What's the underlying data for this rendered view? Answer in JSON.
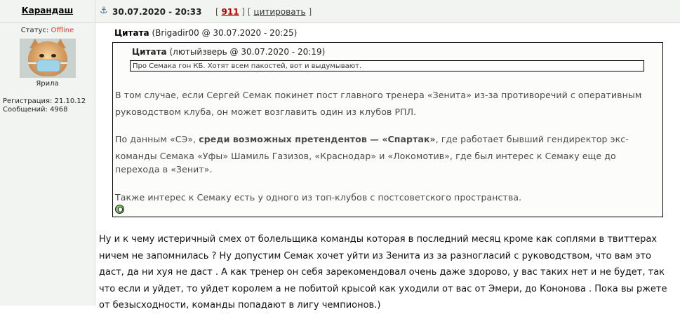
{
  "user": {
    "username": "Карандаш",
    "status_label": "Статус:",
    "status_value": "Offline",
    "avatar_caption": "Ярила",
    "registration_label": "Регистрация:",
    "registration_value": "21.10.12",
    "messages_label": "Сообщений:",
    "messages_value": "4968"
  },
  "post": {
    "datetime": "30.07.2020 - 20:33",
    "bracket_open": "[",
    "number": "911",
    "bracket_sep": "] [",
    "cite_label": "цитировать",
    "bracket_close": "]"
  },
  "quote": {
    "label": "Цитата",
    "meta": "(Brigadir00 @ 30.07.2020 - 20:25)",
    "inner_label": "Цитата",
    "inner_meta": "(лютыйзверь @ 30.07.2020 - 20:19)",
    "inner_text": "Про Семака гон КБ. Хотят всем пакостей, вот и выдумывают.",
    "p1_line1": "В том случае, если Сергей Семак покинет пост главного тренера «Зенита» из-за противоречий с оперативным",
    "p1_line2": "руководством клуба, он может возглавить один из клубов РПЛ.",
    "p2_line1_a": "По данным «СЭ», ",
    "p2_line1_bold": "среди возможных претендентов — «Спартак»",
    "p2_line1_b": ", где работает бывший гендиректор экс-",
    "p2_line2": "команды Семака «Уфы» Шамиль Газизов, «Краснодар» и «Локомотив», где был интерес к Семаку еще до",
    "p2_line3": "перехода в «Зенит».",
    "p3_line1": "Также интерес к Семаку есть у одного из топ-клубов с постсоветского пространства."
  },
  "reply": {
    "line1": "Ну и к чему истеричный смех от болельщика команды которая в последний месяц кроме как соплями в твиттерах",
    "line2": "ничем не запомнилась ? Ну допустим Семак хочет уйти из Зенита из за разногласий с руководством, что вам это",
    "line3": "даст, да ни хуя не даст . А как тренер он себя зарекомендовал очень даже здорово, у вас таких нет и не будет, так",
    "line4": "что если и уйдет, то уйдет королем а не побитой крысой как уходили от вас от Эмери, до Кононова . Пока вы ржете",
    "line5": "от безысходности, команды попадают в лигу чемпионов.)"
  },
  "colors": {
    "offline": "#e03a2a",
    "post_number": "#c00000",
    "panel_bg": "#f1f4f0"
  }
}
